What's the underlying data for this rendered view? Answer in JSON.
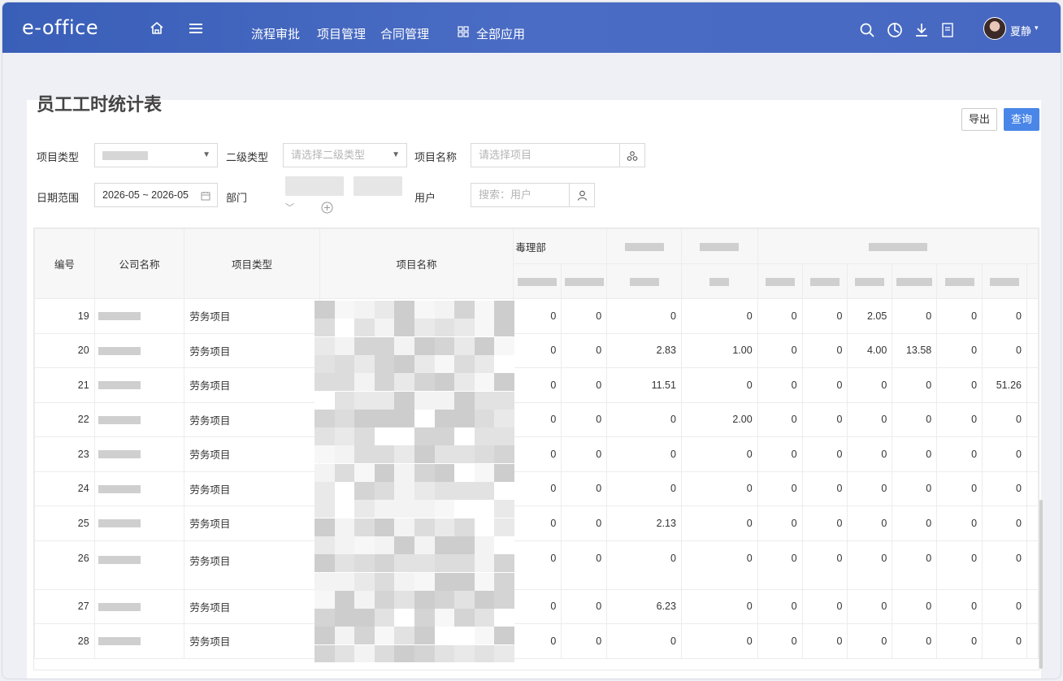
{
  "app": {
    "logo": "e-office",
    "nav": [
      "流程审批",
      "项目管理",
      "合同管理"
    ],
    "all_apps": "全部应用",
    "username": "夏静"
  },
  "page": {
    "title": "员工工时统计表",
    "export_label": "导出",
    "query_label": "查询"
  },
  "filters": {
    "project_type_label": "项目类型",
    "secondary_type_label": "二级类型",
    "secondary_type_placeholder": "请选择二级类型",
    "project_name_label": "项目名称",
    "project_name_placeholder": "请选择项目",
    "date_range_label": "日期范围",
    "date_range_value": "2026-05 ~ 2026-05",
    "department_label": "部门",
    "user_label": "用户",
    "user_placeholder": "搜索：用户"
  },
  "table": {
    "headers": {
      "index": "编号",
      "company": "公司名称",
      "project_type": "项目类型",
      "project_name": "项目名称",
      "group_partial": "毒理部"
    },
    "rows": [
      {
        "idx": "19",
        "type": "劳务项目",
        "vals": [
          "0",
          "0",
          "0",
          "0",
          "0",
          "0",
          "2.05",
          "0",
          "0",
          "0"
        ]
      },
      {
        "idx": "20",
        "type": "劳务项目",
        "vals": [
          "0",
          "0",
          "2.83",
          "1.00",
          "0",
          "0",
          "4.00",
          "13.58",
          "0",
          "0"
        ]
      },
      {
        "idx": "21",
        "type": "劳务项目",
        "vals": [
          "0",
          "0",
          "11.51",
          "0",
          "0",
          "0",
          "0",
          "0",
          "0",
          "51.26"
        ]
      },
      {
        "idx": "22",
        "type": "劳务项目",
        "vals": [
          "0",
          "0",
          "0",
          "2.00",
          "0",
          "0",
          "0",
          "0",
          "0",
          "0"
        ]
      },
      {
        "idx": "23",
        "type": "劳务项目",
        "vals": [
          "0",
          "0",
          "0",
          "0",
          "0",
          "0",
          "0",
          "0",
          "0",
          "0"
        ]
      },
      {
        "idx": "24",
        "type": "劳务项目",
        "vals": [
          "0",
          "0",
          "0",
          "0",
          "0",
          "0",
          "0",
          "0",
          "0",
          "0"
        ]
      },
      {
        "idx": "25",
        "type": "劳务项目",
        "vals": [
          "0",
          "0",
          "2.13",
          "0",
          "0",
          "0",
          "0",
          "0",
          "0",
          "0"
        ]
      },
      {
        "idx": "26",
        "type": "劳务项目",
        "vals": [
          "0",
          "0",
          "0",
          "0",
          "0",
          "0",
          "0",
          "0",
          "0",
          "0"
        ]
      },
      {
        "idx": "27",
        "type": "劳务项目",
        "vals": [
          "0",
          "0",
          "6.23",
          "0",
          "0",
          "0",
          "0",
          "0",
          "0",
          "0"
        ]
      },
      {
        "idx": "28",
        "type": "劳务项目",
        "vals": [
          "0",
          "0",
          "0",
          "0",
          "0",
          "0",
          "0",
          "0",
          "0",
          "0"
        ]
      }
    ]
  },
  "colors": {
    "topbar": "#4466c0",
    "primary": "#4a86e8"
  },
  "icons": [
    "home-icon",
    "menu-icon",
    "grid-icon",
    "search-icon",
    "clock-icon",
    "download-icon",
    "document-icon",
    "calendar-icon",
    "network-icon",
    "user-icon",
    "plus-circle-icon",
    "chevron-down-icon"
  ]
}
